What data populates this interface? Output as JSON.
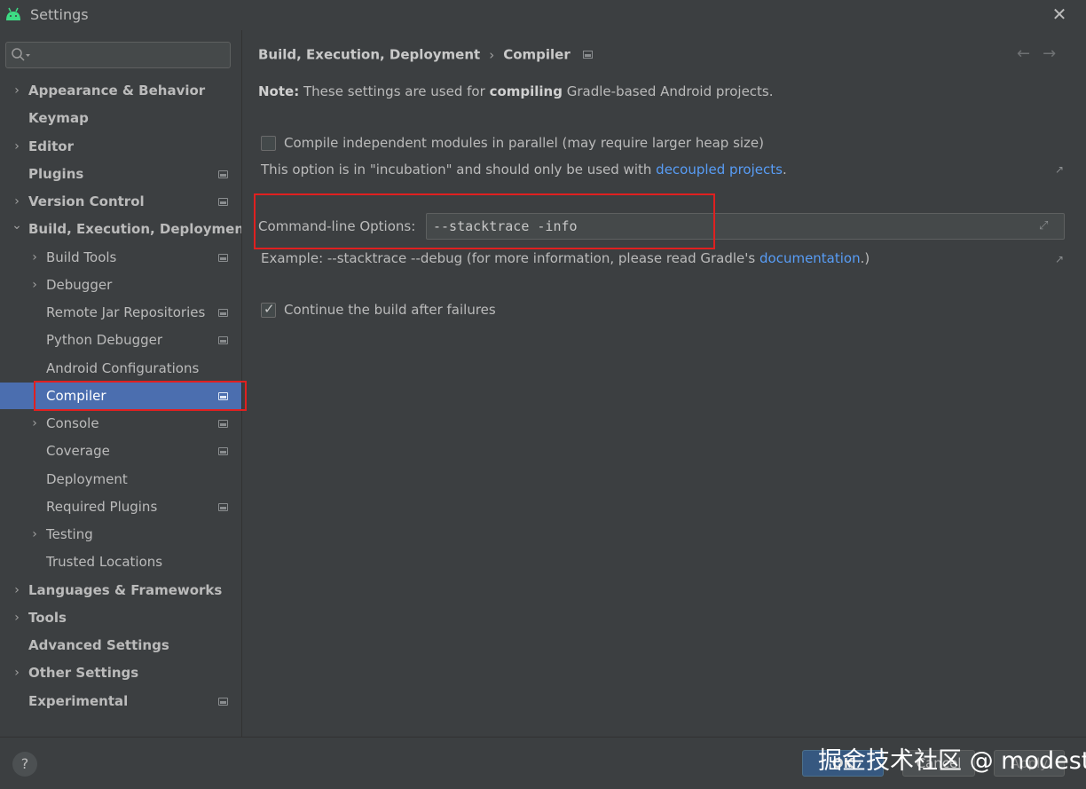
{
  "window": {
    "title": "Settings",
    "close_glyph": "✕"
  },
  "search": {
    "placeholder": "",
    "icon": "search-icon"
  },
  "sidebar": {
    "items": [
      {
        "label": "Appearance & Behavior",
        "chevron": "›"
      },
      {
        "label": "Keymap"
      },
      {
        "label": "Editor",
        "chevron": "›"
      },
      {
        "label": "Plugins"
      },
      {
        "label": "Version Control",
        "chevron": "›"
      },
      {
        "label": "Build, Execution, Deployment",
        "chevron": "⌄"
      },
      {
        "label": "Build Tools",
        "chevron": "›"
      },
      {
        "label": "Debugger",
        "chevron": "›"
      },
      {
        "label": "Remote Jar Repositories"
      },
      {
        "label": "Python Debugger"
      },
      {
        "label": "Android Configurations"
      },
      {
        "label": "Compiler"
      },
      {
        "label": "Console",
        "chevron": "›"
      },
      {
        "label": "Coverage"
      },
      {
        "label": "Deployment"
      },
      {
        "label": "Required Plugins"
      },
      {
        "label": "Testing",
        "chevron": "›"
      },
      {
        "label": "Trusted Locations"
      },
      {
        "label": "Languages & Frameworks",
        "chevron": "›"
      },
      {
        "label": "Tools",
        "chevron": "›"
      },
      {
        "label": "Advanced Settings"
      },
      {
        "label": "Other Settings",
        "chevron": "›"
      },
      {
        "label": "Experimental"
      }
    ]
  },
  "breadcrumb": {
    "parent": "Build, Execution, Deployment",
    "separator": "›",
    "current": "Compiler"
  },
  "nav": {
    "back": "←",
    "forward": "→"
  },
  "note": {
    "prefix": "Note:",
    "text_before": "These settings are used for",
    "emphasis": "compiling",
    "text_after": "Gradle-based Android projects."
  },
  "parallel": {
    "label": "Compile independent modules in parallel (may require larger heap size)",
    "checked": false,
    "hint_before": "This option is in \"incubation\" and should only be used with",
    "hint_link": "decoupled projects",
    "hint_after": "."
  },
  "command_line": {
    "label": "Command-line Options:",
    "value": "--stacktrace -info",
    "example_before": "Example: --stacktrace --debug (for more information, please read Gradle's",
    "example_link": "documentation",
    "example_after": ".)"
  },
  "continue_build": {
    "label": "Continue the build after failures",
    "checked": true
  },
  "footer": {
    "help": "?",
    "ok": "OK",
    "cancel": "Cancel",
    "apply": "Apply",
    "caption": "掘金技术社区 @ modest"
  },
  "colors": {
    "background": "#3c3f41",
    "selection": "#4b6eaf",
    "link": "#589df6",
    "highlight_box": "#e02020"
  }
}
